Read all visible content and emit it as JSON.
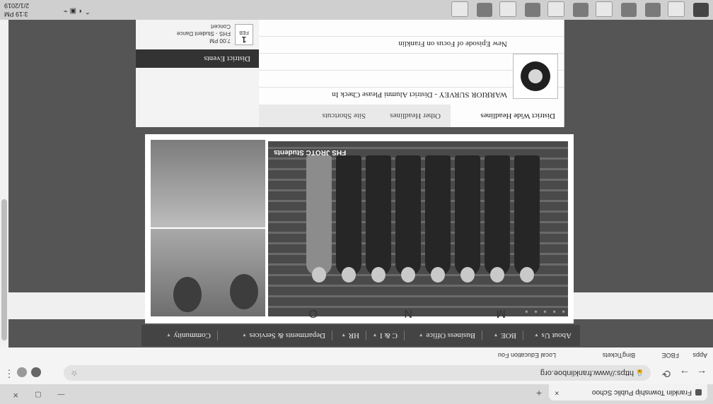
{
  "browser": {
    "tab_title": "Franklin Township Public Schoo",
    "tab_close": "×",
    "new_tab": "+",
    "window_controls": "—  ▢  ✕",
    "url": "https://www.franklinboe.org",
    "back": "←",
    "forward": "→",
    "reload": "⟳",
    "star": "☆",
    "menu": "⋮",
    "bookmarks": [
      "Apps",
      "FBOE",
      "BingTickets",
      "Local Education Fou"
    ]
  },
  "nav": {
    "items": [
      "About Us",
      "BOE",
      "Business Office",
      "C & I",
      "HR",
      "Departments & Services",
      "Community"
    ],
    "caret": "▾"
  },
  "hero": {
    "caption": "FHS JROTC Students",
    "dots": "● ● ● ● ●",
    "letters": [
      "M",
      "N",
      "O"
    ]
  },
  "news": {
    "tabs": [
      "District Wide Headlines",
      "Other Headlines",
      "Site Shortcuts"
    ],
    "items": [
      "WARRIOR SURVEY - District Alumni Please Check In",
      "New Episode of Focus on Franklin"
    ]
  },
  "events": {
    "title": "District Events",
    "month": "FEB",
    "day": "1",
    "time": "7:00 PM",
    "line1": "FHS - Student Dance",
    "line2": "Concert"
  },
  "taskbar": {
    "time": "3:19 PM",
    "date": "2/1/2019",
    "tray": "⌃ ◖ ▣ ⌁"
  }
}
